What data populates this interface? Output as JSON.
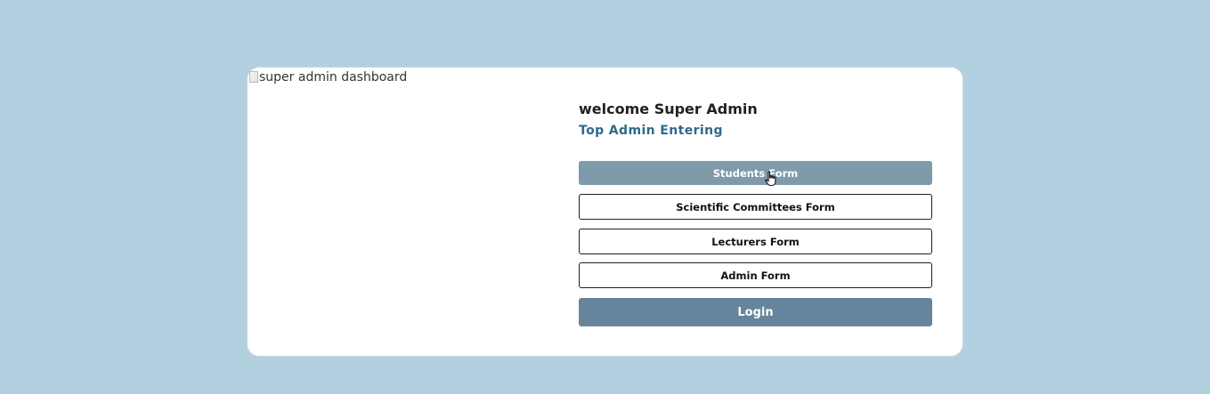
{
  "dashboard": {
    "image_alt": "super admin dashboard",
    "welcome_title": "welcome Super Admin",
    "subtitle": "Top Admin Entering"
  },
  "buttons": {
    "students_form": "Students Form",
    "scientific_committees_form": "Scientific Committees Form",
    "lecturers_form": "Lecturers Form",
    "admin_form": "Admin Form",
    "login": "Login"
  },
  "icons": {
    "broken_image": "broken-image-icon",
    "cursor": "hand-pointer-cursor-icon"
  },
  "colors": {
    "background": "#b2d0e0",
    "card": "#ffffff",
    "subtitle": "#2e6a8a",
    "button_hover": "#7f9aa9",
    "login_button": "#66859c"
  }
}
